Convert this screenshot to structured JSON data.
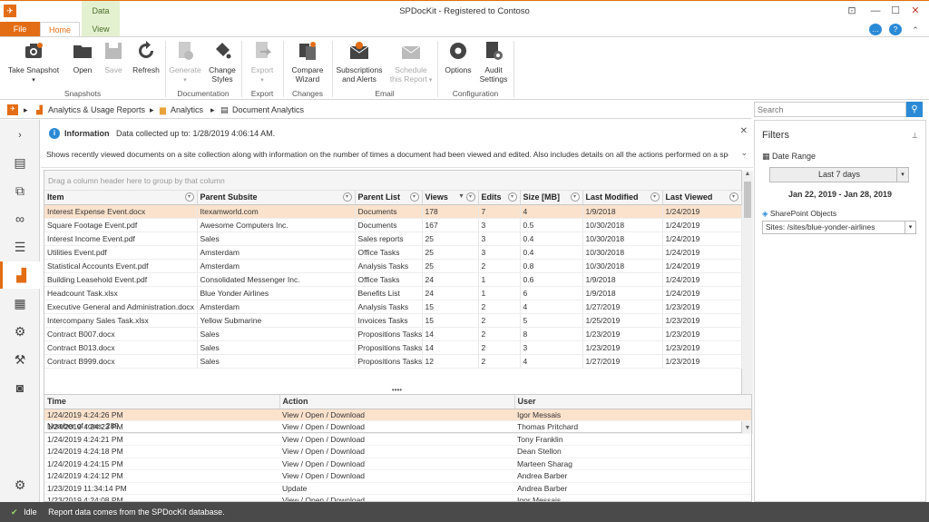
{
  "window": {
    "title": "SPDocKit - Registered to Contoso",
    "context_tab": "Data"
  },
  "tabs": {
    "file": "File",
    "home": "Home",
    "view": "View"
  },
  "ribbon": {
    "take_snapshot": "Take Snapshot",
    "open": "Open",
    "save": "Save",
    "refresh": "Refresh",
    "generate": "Generate",
    "change_styles": "Change Styles",
    "export": "Export",
    "compare_wizard": "Compare Wizard",
    "subscriptions_alerts": "Subscriptions and Alerts",
    "schedule_report": "Schedule this Report",
    "options": "Options",
    "audit_settings": "Audit Settings",
    "groups": {
      "snapshots": "Snapshots",
      "documentation": "Documentation",
      "export": "Export",
      "changes": "Changes",
      "email": "Email",
      "configuration": "Configuration"
    }
  },
  "breadcrumb": {
    "item1": "Analytics & Usage Reports",
    "item2": "Analytics",
    "item3": "Document Analytics"
  },
  "search": {
    "placeholder": "Search"
  },
  "info": {
    "label": "Information",
    "collected": "Data collected up to: 1/28/2019 4:06:14 AM.",
    "description": "Shows recently viewed documents on a site collection along with information on the number of times a document had been viewed and edited. Also includes details on all the actions performed on a specific doc."
  },
  "grid": {
    "groupby_hint": "Drag a column header here to group by that column",
    "columns": [
      "Item",
      "Parent Subsite",
      "Parent List",
      "Views",
      "Edits",
      "Size [MB]",
      "Last Modified",
      "Last Viewed"
    ],
    "rows": [
      [
        "Interest Expense Event.docx",
        "Itexamworld.com",
        "Documents",
        "178",
        "7",
        "4",
        "1/9/2018",
        "1/24/2019"
      ],
      [
        "Square Footage Event.pdf",
        "Awesome Computers Inc.",
        "Documents",
        "167",
        "3",
        "0.5",
        "10/30/2018",
        "1/24/2019"
      ],
      [
        "Interest Income Event.pdf",
        "Sales",
        "Sales reports",
        "25",
        "3",
        "0.4",
        "10/30/2018",
        "1/24/2019"
      ],
      [
        "Utilities Event.pdf",
        "Amsterdam",
        "Office Tasks",
        "25",
        "3",
        "0.4",
        "10/30/2018",
        "1/24/2019"
      ],
      [
        "Statistical Accounts Event.pdf",
        "Amsterdam",
        "Analysis Tasks",
        "25",
        "2",
        "0.8",
        "10/30/2018",
        "1/24/2019"
      ],
      [
        "Building Leasehold Event.pdf",
        "Consolidated Messenger Inc.",
        "Office Tasks",
        "24",
        "1",
        "0.6",
        "1/9/2018",
        "1/24/2019"
      ],
      [
        "Headcount Task.xlsx",
        "Blue Yonder Airlines",
        "Benefits List",
        "24",
        "1",
        "6",
        "1/9/2018",
        "1/24/2019"
      ],
      [
        "Executive General and Administration.docx",
        "Amsterdam",
        "Analysis Tasks",
        "15",
        "2",
        "4",
        "1/27/2019",
        "1/23/2019"
      ],
      [
        "Intercompany Sales Task.xlsx",
        "Yellow Submarine",
        "Invoices Tasks",
        "15",
        "2",
        "5",
        "1/25/2019",
        "1/23/2019"
      ],
      [
        "Contract B007.docx",
        "Sales",
        "Propositions Tasks",
        "14",
        "2",
        "8",
        "1/23/2019",
        "1/23/2019"
      ],
      [
        "Contract B013.docx",
        "Sales",
        "Propositions Tasks",
        "14",
        "2",
        "3",
        "1/23/2019",
        "1/23/2019"
      ],
      [
        "Contract B999.docx",
        "Sales",
        "Propositions Tasks",
        "12",
        "2",
        "4",
        "1/27/2019",
        "1/23/2019"
      ]
    ],
    "row_count": "Number of rows: 289"
  },
  "detail": {
    "columns": [
      "Time",
      "Action",
      "User"
    ],
    "rows": [
      [
        "1/24/2019 4:24:26 PM",
        "View / Open / Download",
        "Igor Messais"
      ],
      [
        "1/24/2019 4:24:23 PM",
        "View / Open / Download",
        "Thomas Pritchard"
      ],
      [
        "1/24/2019 4:24:21 PM",
        "View / Open / Download",
        "Tony Franklin"
      ],
      [
        "1/24/2019 4:24:18 PM",
        "View / Open / Download",
        "Dean Stellon"
      ],
      [
        "1/24/2019 4:24:15 PM",
        "View / Open / Download",
        "Marteen Sharag"
      ],
      [
        "1/24/2019 4:24:12 PM",
        "View / Open / Download",
        "Andrea Barber"
      ],
      [
        "1/23/2019 11:34:14 PM",
        "Update",
        "Andrea Barber"
      ],
      [
        "1/23/2019 4:24:08 PM",
        "View / Open / Download",
        "Igor Messais"
      ]
    ]
  },
  "filters": {
    "title": "Filters",
    "date_range_label": "Date Range",
    "date_range_value": "Last 7 days",
    "date_span": "Jan 22, 2019 - Jan 28, 2019",
    "sp_objects_label": "SharePoint Objects",
    "sp_objects_value": "Sites: /sites/blue-yonder-airlines"
  },
  "status": {
    "state": "Idle",
    "message": "Report data comes from the SPDocKit database."
  },
  "colors": {
    "accent": "#e36d14",
    "selection": "#fbe2cc",
    "context_tab": "#e4f1d0",
    "info": "#2b8ad6"
  }
}
